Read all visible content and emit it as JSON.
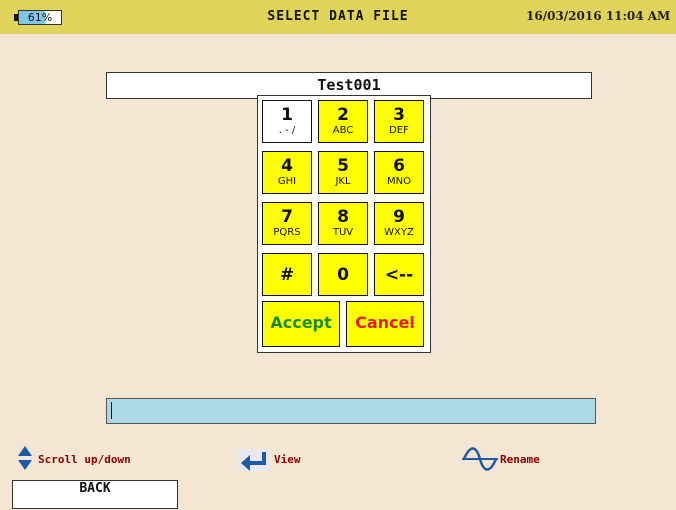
{
  "header": {
    "battery_percent": "61%",
    "battery_level": 0.61,
    "title": "SELECT DATA FILE",
    "datetime": "16/03/2016 11:04 AM"
  },
  "filename": "Test001",
  "keypad": {
    "keys": [
      {
        "main": "1",
        "sub": ". - /"
      },
      {
        "main": "2",
        "sub": "ABC"
      },
      {
        "main": "3",
        "sub": "DEF"
      },
      {
        "main": "4",
        "sub": "GHI"
      },
      {
        "main": "5",
        "sub": "JKL"
      },
      {
        "main": "6",
        "sub": "MNO"
      },
      {
        "main": "7",
        "sub": "PQRS"
      },
      {
        "main": "8",
        "sub": "TUV"
      },
      {
        "main": "9",
        "sub": "WXYZ"
      },
      {
        "main": "#"
      },
      {
        "main": "0"
      },
      {
        "main": "<--"
      }
    ],
    "accept_label": "Accept",
    "cancel_label": "Cancel"
  },
  "input": {
    "value": ""
  },
  "hints": {
    "scroll": "Scroll up/down",
    "view": "View",
    "rename": "Rename"
  },
  "back_label": "BACK",
  "colors": {
    "background": "#f5e6d3",
    "titlebar": "#dfd35a",
    "key": "#ffff00",
    "accept": "#1a8c1a",
    "cancel": "#e41a1a",
    "input_bar": "#add8e6",
    "hint_text": "#8b0000",
    "icon_blue": "#1e5aa8"
  }
}
